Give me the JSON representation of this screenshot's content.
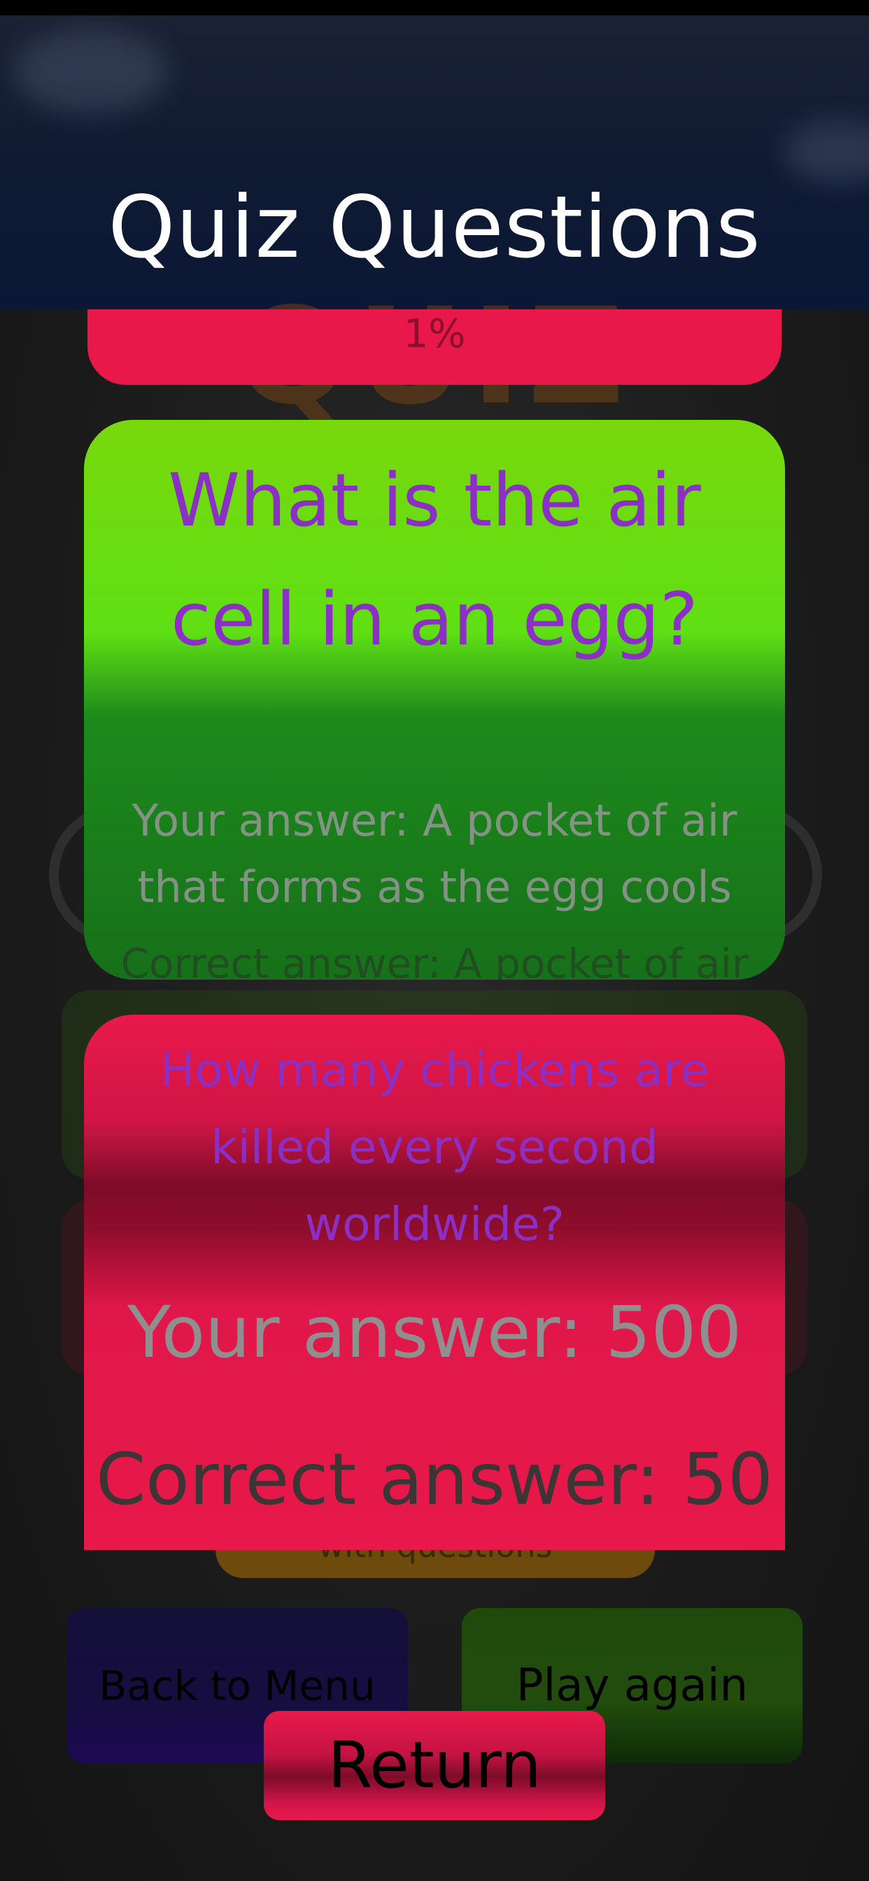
{
  "header": {
    "title": "Quiz Questions"
  },
  "background": {
    "logo_text": "QUIZ",
    "hidden_button_label": "with questions"
  },
  "score_bar": {
    "percent_text": "1%"
  },
  "results": [
    {
      "question": "What is the air cell in an egg?",
      "your_answer": "Your answer: A pocket of air that forms as the egg cools",
      "correct_answer": "Correct answer: A pocket of air that forms as the egg cools",
      "status": "correct"
    },
    {
      "question": "How many chickens are killed every second worldwide?",
      "your_answer": "Your answer: 500",
      "correct_answer": "Correct answer: 50",
      "status": "wrong"
    }
  ],
  "buttons": {
    "back_to_menu": "Back to Menu",
    "play_again": "Play again",
    "return": "Return"
  },
  "colors": {
    "correct_card": "#5fe014",
    "wrong_card": "#e8194a",
    "question_text": "#8b2fc5",
    "title_text": "#ffffff"
  }
}
